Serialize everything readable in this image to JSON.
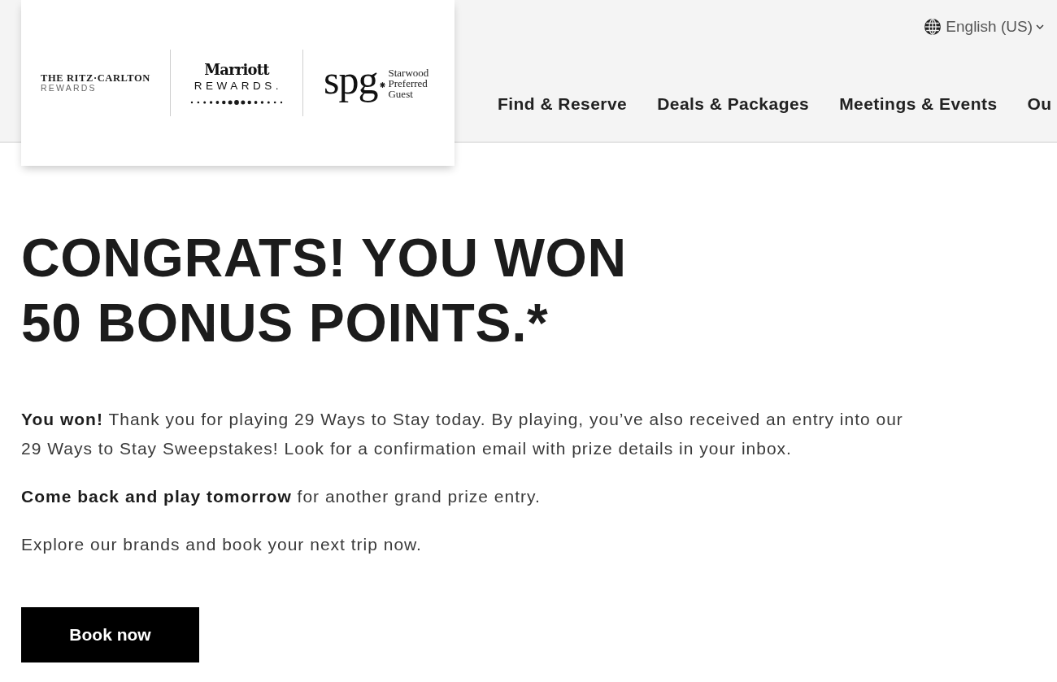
{
  "header": {
    "logos": {
      "ritz_carlton": {
        "name": "THE RITZ·CARLTON",
        "tagline": "REWARDS"
      },
      "marriott": {
        "name": "Marriott",
        "tagline": "REWARDS."
      },
      "spg": {
        "monogram": "spg",
        "caption": "Starwood Preferred Guest"
      }
    },
    "language": {
      "label": "English (US)"
    },
    "nav": [
      {
        "label": "Find & Reserve"
      },
      {
        "label": "Deals & Packages"
      },
      {
        "label": "Meetings & Events"
      },
      {
        "label": "Ou"
      }
    ]
  },
  "main": {
    "heading": "CONGRATS! YOU WON 50 BONUS POINTS.*",
    "paragraphs": [
      "**You won!** Thank you for playing 29 Ways to Stay today. By playing, you’ve also received an entry into our 29 Ways to Stay Sweepstakes! Look for a confirmation email with prize details in your inbox.",
      "**Come back and play tomorrow** for another grand prize entry.",
      "Explore our brands and book your next trip now."
    ],
    "button": {
      "label": "Book now"
    }
  }
}
